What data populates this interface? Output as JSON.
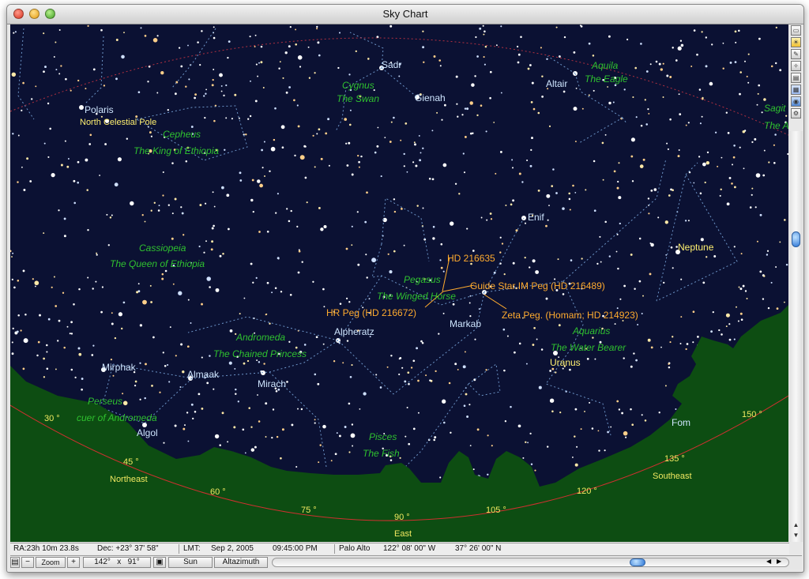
{
  "window": {
    "title": "Sky Chart"
  },
  "sky": {
    "bright_stars": [
      {
        "name": "Sadr"
      },
      {
        "name": "Gienah"
      },
      {
        "name": "Altair"
      },
      {
        "name": "Polaris"
      },
      {
        "name": "Enif"
      },
      {
        "name": "Markab"
      },
      {
        "name": "Alpheratz"
      },
      {
        "name": "Mirphak"
      },
      {
        "name": "Almaak"
      },
      {
        "name": "Mirach"
      },
      {
        "name": "Algol"
      },
      {
        "name": "Fom"
      }
    ],
    "special_labels": [
      {
        "name": "North Celestial Pole"
      },
      {
        "name": "Neptune"
      },
      {
        "name": "Uranus"
      }
    ],
    "constellations": [
      {
        "name": "Cygnus",
        "desc": "The Swan"
      },
      {
        "name": "Aquila",
        "desc": "The Eagle"
      },
      {
        "name": "Cepheus",
        "desc": "The King of Ethiopia"
      },
      {
        "name": "Cassiopeia",
        "desc": "The Queen of Ethiopia"
      },
      {
        "name": "Pegasus",
        "desc": "The Winged Horse"
      },
      {
        "name": "Andromeda",
        "desc": "The Chained Princess"
      },
      {
        "name": "Aquarius",
        "desc": "The Water Bearer"
      },
      {
        "name": "Perseus",
        "desc": "cuer of Andromeda"
      },
      {
        "name": "Pisces",
        "desc": "The Fish"
      },
      {
        "name": "Sagit",
        "desc": "The A"
      }
    ],
    "annotations": [
      {
        "text": "HD 216635"
      },
      {
        "text": "Guide Star IM Peg (HD 216489)"
      },
      {
        "text": "HR Peg (HD 216672)"
      },
      {
        "text": "Zeta Peg. (Homam; HD 214923)"
      }
    ],
    "azimuth_ticks": [
      "30 °",
      "45 °",
      "60 °",
      "75 °",
      "90 °",
      "105 °",
      "120 °",
      "135 °",
      "150 °"
    ],
    "directions": [
      "Northeast",
      "East",
      "Southeast"
    ]
  },
  "status_bar": {
    "ra": "RA:23h 10m 23.8s",
    "dec": "Dec: +23° 37' 58\"",
    "lmt_label": "LMT:",
    "date": "Sep  2, 2005",
    "time": "09:45:00 PM",
    "location": "Palo Alto",
    "longitude": "122° 08' 00\" W",
    "latitude": "37° 26' 00\" N"
  },
  "toolbar": {
    "zoom_label": "Zoom",
    "zoom_minus": "−",
    "zoom_plus": "+",
    "fov_w": "142°",
    "fov_x": "x",
    "fov_h": "91°",
    "lock_icon": "lock-icon",
    "center_object": "Sun",
    "projection": "Altazimuth"
  },
  "colors": {
    "sky": "#0b1133",
    "ground": "#0d4d12",
    "constellation_name": "#2fc12f",
    "annotation": "#ffab2e",
    "planet_label": "#fff070"
  }
}
